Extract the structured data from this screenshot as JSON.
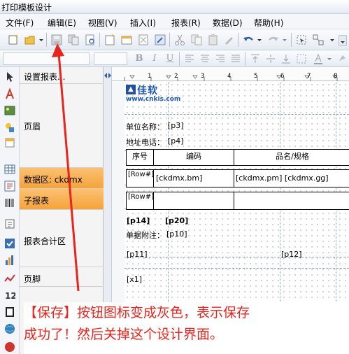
{
  "window": {
    "title": "打印模板设计"
  },
  "menu": [
    "文件(F)",
    "编辑(E)",
    "视图(V)",
    "插入(I)",
    "报表(R)",
    "数据(D)",
    "帮助(H)"
  ],
  "toolbar": {
    "icons": [
      "new-icon",
      "open-icon",
      "save-icon",
      "copy-template-icon",
      "preview-icon",
      "page-setup-icon",
      "band-icon",
      "delete-icon",
      "wizard-icon",
      "cut-icon",
      "copy-icon",
      "paste-icon",
      "format-painter-icon",
      "undo-icon",
      "redo-icon",
      "select-icon",
      "layout-icon"
    ],
    "format_buttons": [
      "B",
      "I",
      "U"
    ]
  },
  "left_tools": [
    "pointer-icon",
    "text-tool-icon",
    "image-tool-icon",
    "shapes-tool-icon",
    "band-tool-icon",
    "table-tool-icon",
    "richtext-tool-icon",
    "barcode-tool-icon",
    "field-tool-icon",
    "checkbox-tool-icon",
    "chart-tool-icon",
    "line-tool-icon",
    "number-tool-icon",
    "page-tool-icon",
    "globe-tool-icon",
    "misc-tool-icon"
  ],
  "bands": {
    "setup": "设置报表...",
    "header": "页眉",
    "data": "数据区: ckdmx",
    "subreport": "子报表",
    "summary": "报表合计区",
    "footer": "页脚"
  },
  "ruler": [
    "1",
    "2",
    "3",
    "4",
    "5",
    "6",
    "7",
    "8"
  ],
  "logo": {
    "name": "佳软",
    "url": "www.cnkis.com"
  },
  "fields": {
    "unit_label": "单位名称：",
    "unit_value": "[p3]",
    "phone_label": "地址电话：",
    "phone_value": "[p4]",
    "col_seq": "序号",
    "col_code": "编码",
    "col_name": "品名/规格",
    "row1_seq": "[Row#]",
    "row1_code": "[ckdmx.bm]",
    "row1_name": "[ckdmx.pm] [ckdmx.gg]",
    "row2_seq": "[Row#]",
    "p14": "[p14]",
    "p20": "[p20]",
    "note_label": "单据附注：",
    "note_value": "[p10]",
    "p11": "[p11]",
    "p12": "[p12]",
    "x1": "[x1]"
  },
  "annotation": {
    "line1": "【保存】按钮图标变成灰色，表示保存",
    "line2": "成功了！然后关掉这个设计界面。",
    "color": "#e8251c"
  }
}
